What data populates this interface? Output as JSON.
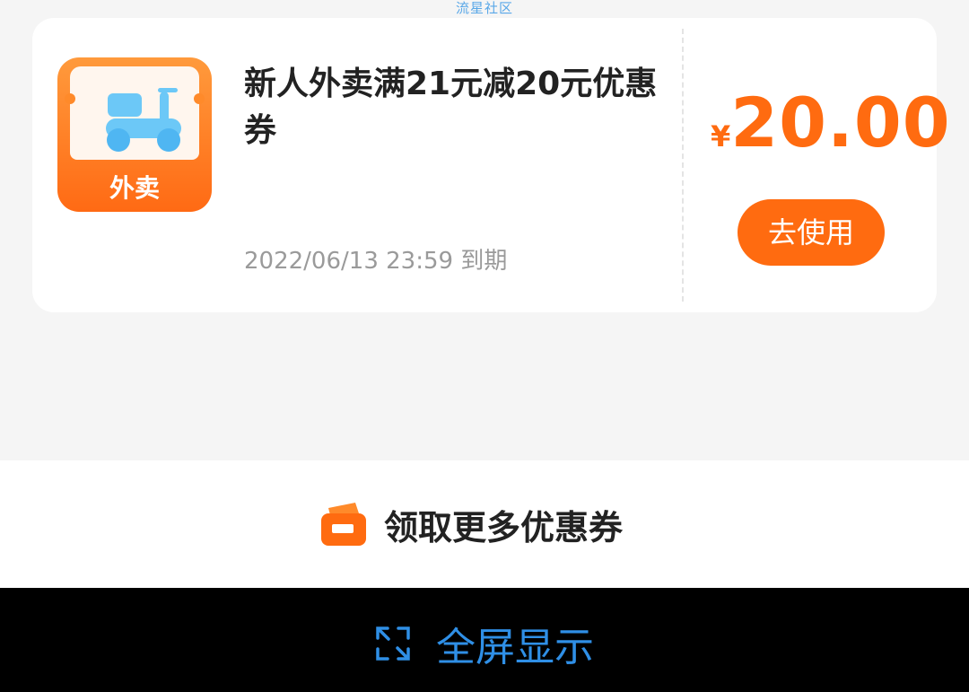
{
  "watermark": "流星社区",
  "coupon": {
    "icon_label": "外卖",
    "title": "新人外卖满21元减20元优惠券",
    "expiry": "2022/06/13 23:59 到期",
    "currency": "¥",
    "amount": "20.00",
    "use_button": "去使用"
  },
  "more_coupons": {
    "label": "领取更多优惠券",
    "icon": "ticket-icon"
  },
  "fullscreen": {
    "label": "全屏显示",
    "icon": "expand-icon"
  },
  "colors": {
    "accent": "#ff6b10",
    "link": "#2f8fe6",
    "bar_bg": "#000000"
  }
}
